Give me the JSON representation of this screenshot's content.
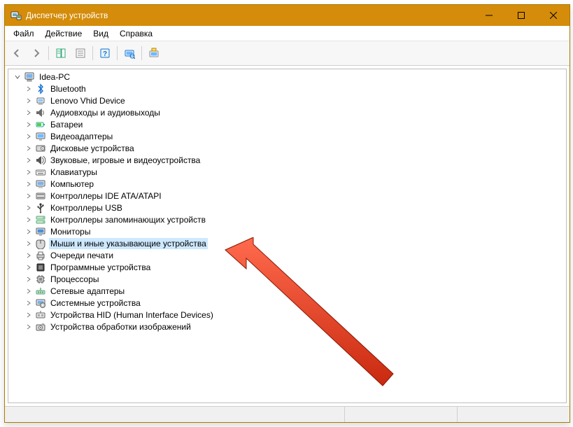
{
  "window": {
    "title": "Диспетчер устройств"
  },
  "menubar": {
    "items": [
      "Файл",
      "Действие",
      "Вид",
      "Справка"
    ]
  },
  "tree": {
    "root": {
      "label": "Idea-PC",
      "expanded": true
    },
    "categories": [
      {
        "icon": "bluetooth",
        "label": "Bluetooth"
      },
      {
        "icon": "lenovo",
        "label": "Lenovo Vhid Device"
      },
      {
        "icon": "audio",
        "label": "Аудиовходы и аудиовыходы"
      },
      {
        "icon": "battery",
        "label": "Батареи"
      },
      {
        "icon": "display",
        "label": "Видеоадаптеры"
      },
      {
        "icon": "disk",
        "label": "Дисковые устройства"
      },
      {
        "icon": "sound",
        "label": "Звуковые, игровые и видеоустройства"
      },
      {
        "icon": "keyboard",
        "label": "Клавиатуры"
      },
      {
        "icon": "computer",
        "label": "Компьютер"
      },
      {
        "icon": "ide",
        "label": "Контроллеры IDE ATA/ATAPI"
      },
      {
        "icon": "usb",
        "label": "Контроллеры USB"
      },
      {
        "icon": "storage",
        "label": "Контроллеры запоминающих устройств"
      },
      {
        "icon": "monitor",
        "label": "Мониторы"
      },
      {
        "icon": "mouse",
        "label": "Мыши и иные указывающие устройства",
        "selected": true
      },
      {
        "icon": "printqueue",
        "label": "Очереди печати"
      },
      {
        "icon": "software",
        "label": "Программные устройства"
      },
      {
        "icon": "cpu",
        "label": "Процессоры"
      },
      {
        "icon": "network",
        "label": "Сетевые адаптеры"
      },
      {
        "icon": "system",
        "label": "Системные устройства"
      },
      {
        "icon": "hid",
        "label": "Устройства HID (Human Interface Devices)"
      },
      {
        "icon": "imaging",
        "label": "Устройства обработки изображений"
      }
    ]
  }
}
